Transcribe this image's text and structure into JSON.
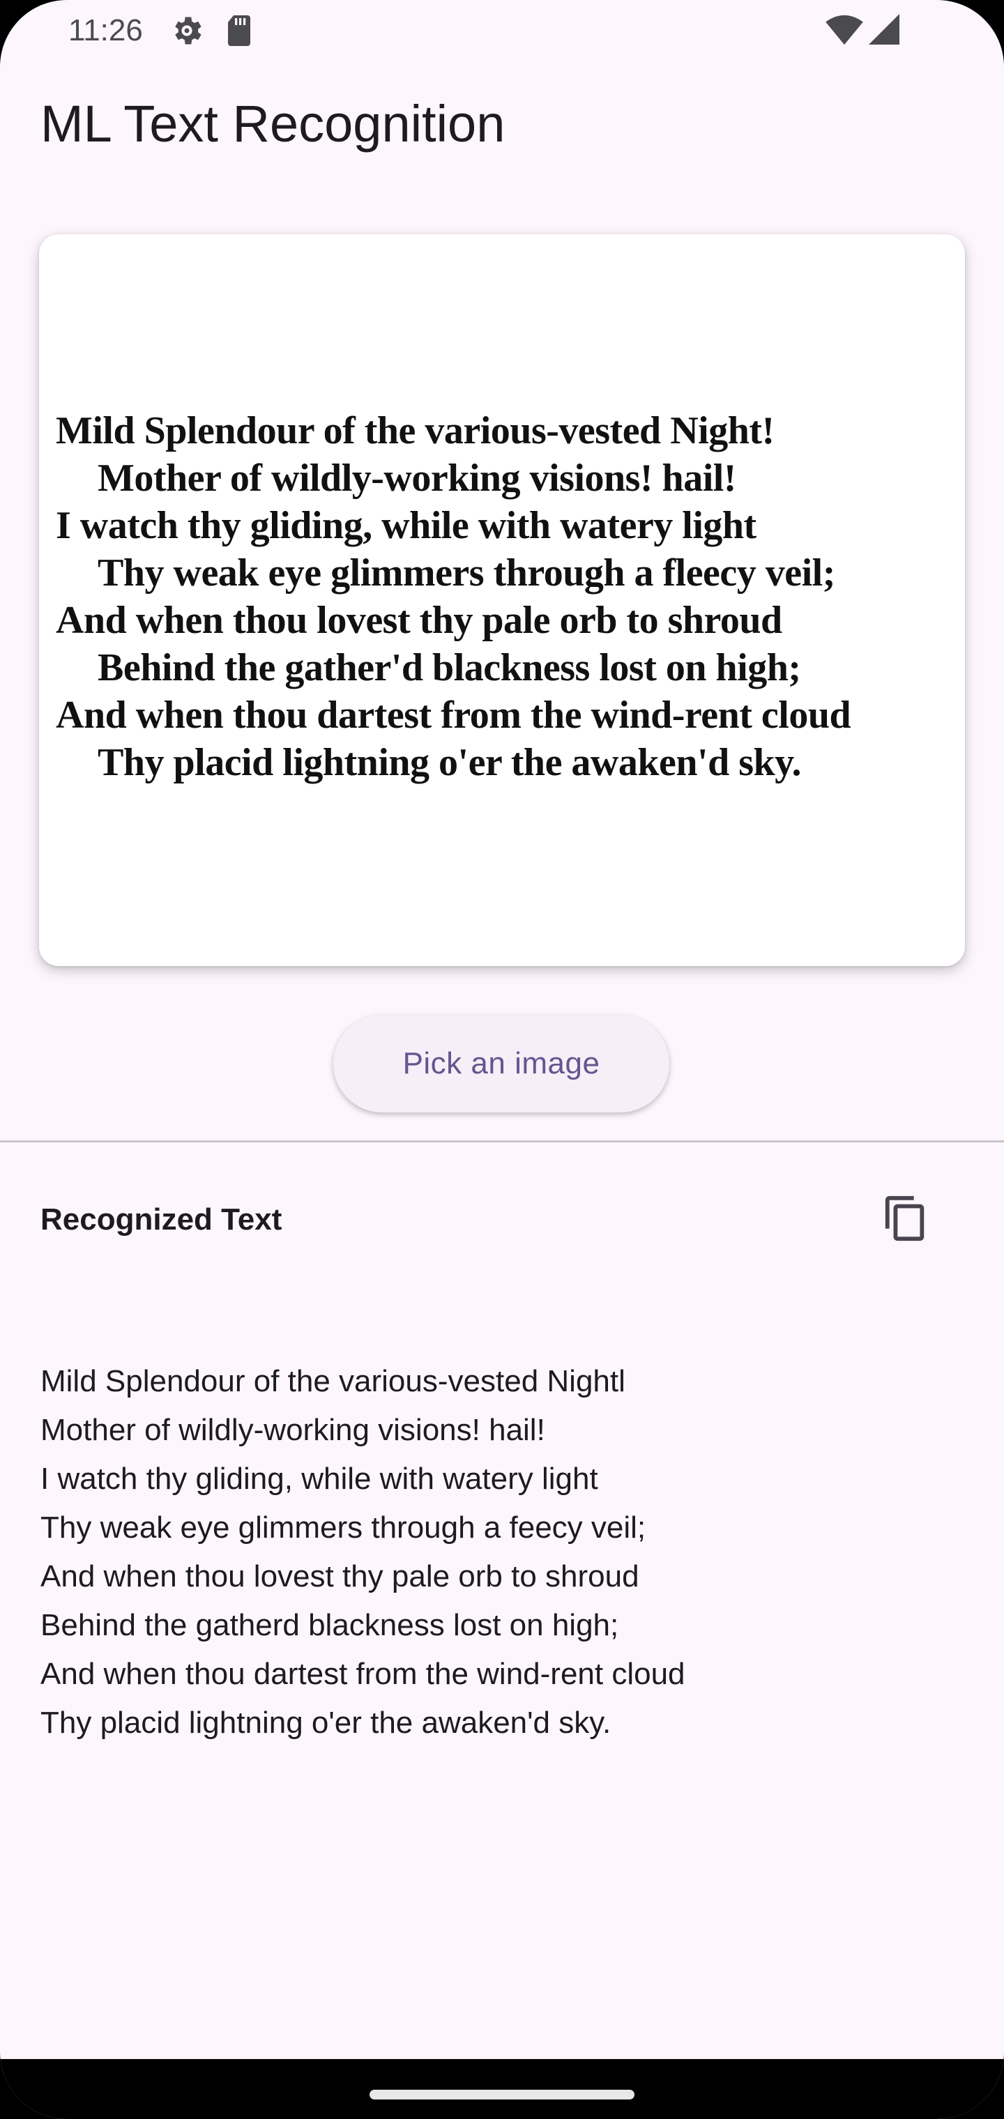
{
  "status_bar": {
    "time": "11:26",
    "icons": [
      "gear-icon",
      "sd-card-icon",
      "wifi-icon",
      "cell-signal-icon"
    ]
  },
  "app": {
    "title": "ML Text Recognition"
  },
  "image_card": {
    "poem_lines": [
      {
        "text": "Mild Splendour of the various-vested Night!",
        "indent": false
      },
      {
        "text": "Mother of wildly-working visions! hail!",
        "indent": true
      },
      {
        "text": "I watch thy gliding, while with watery light",
        "indent": false
      },
      {
        "text": "Thy weak eye glimmers through a fleecy veil;",
        "indent": true
      },
      {
        "text": "And when thou lovest thy pale orb to shroud",
        "indent": false
      },
      {
        "text": "Behind the gather'd blackness lost on high;",
        "indent": true
      },
      {
        "text": "And when thou dartest from the wind-rent cloud",
        "indent": false
      },
      {
        "text": "Thy placid lightning o'er the awaken'd sky.",
        "indent": true
      }
    ]
  },
  "actions": {
    "pick_image_label": "Pick an image"
  },
  "result": {
    "title": "Recognized Text",
    "copy_icon": "copy-icon",
    "lines": [
      "Mild Splendour of the various-vested Nightl",
      "Mother of wildly-working visions! hail!",
      "I watch thy gliding, while with watery light",
      "Thy weak eye glimmers through a feecy veil;",
      "And when thou lovest thy pale orb to shroud",
      "Behind the gatherd blackness lost on high;",
      "And when thou dartest from the wind-rent cloud",
      "Thy placid lightning o'er the awaken'd sky."
    ]
  },
  "colors": {
    "background": "#fdf7fd",
    "primary": "#65558f",
    "on_surface": "#1d1b20",
    "button_surface": "#f6eff7",
    "divider": "#cac4d0"
  }
}
